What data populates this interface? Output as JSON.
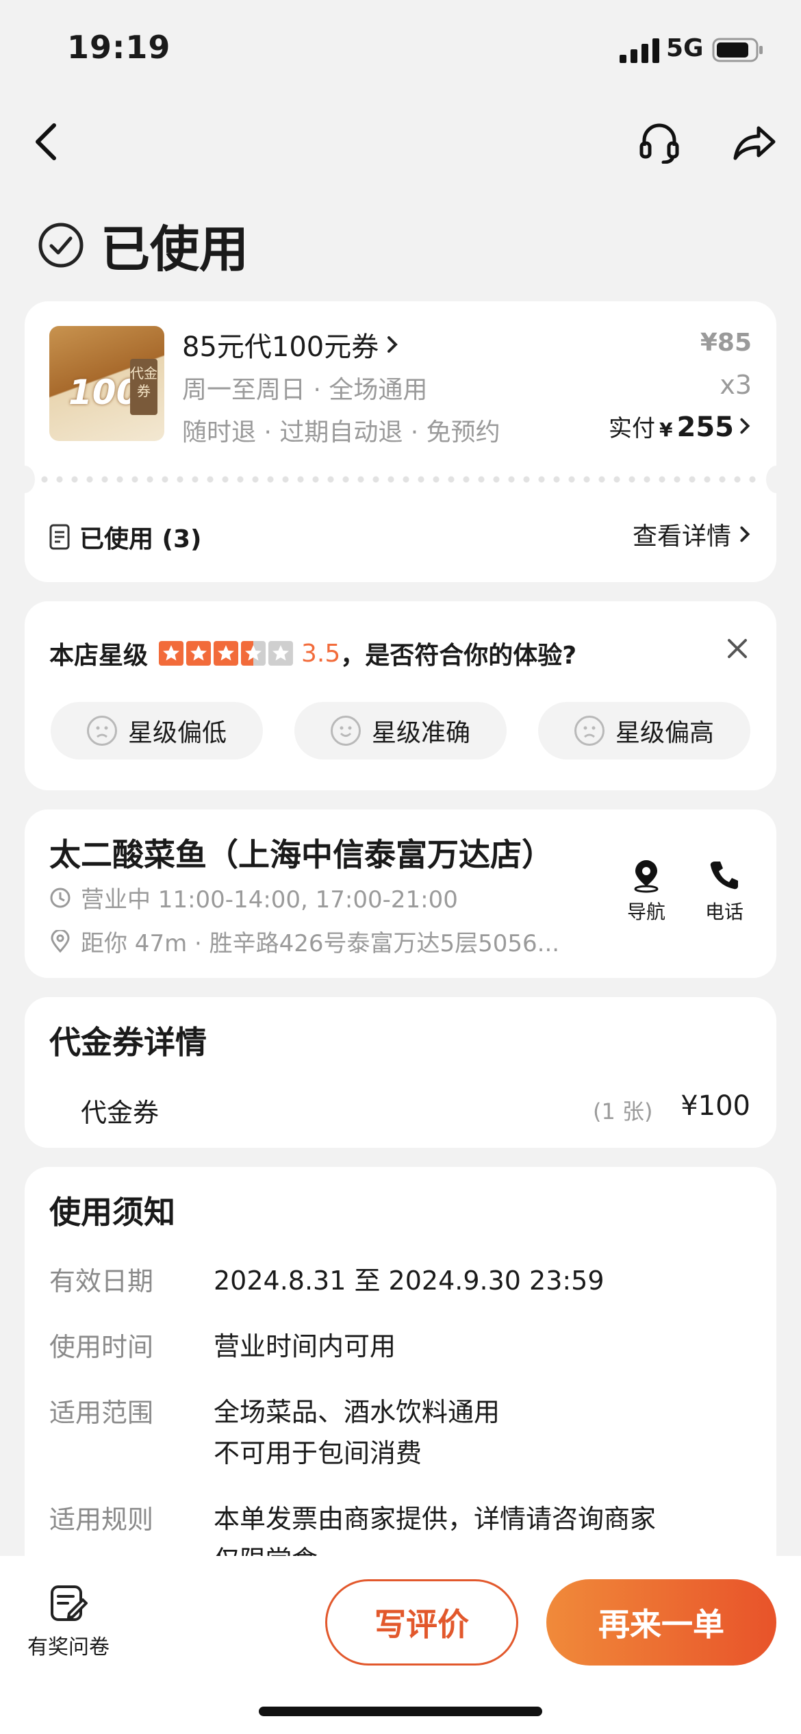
{
  "status_bar": {
    "time": "19:19",
    "network": "5G"
  },
  "header": {
    "status": "已使用"
  },
  "voucher": {
    "title": "85元代100元券",
    "days": "周一至周日 · 全场通用",
    "policy": "随时退 · 过期自动退 · 免预约",
    "unit_price": "¥85",
    "qty": "x3",
    "paid_label": "实付",
    "paid_currency": "¥",
    "paid_amount": "255",
    "thumb_number": "100",
    "thumb_tag": "代金券",
    "used_label": "已使用 (3)",
    "detail_link": "查看详情"
  },
  "rating": {
    "label": "本店星级",
    "score": "3.5",
    "score_value": 3.5,
    "question": "，是否符合你的体验?",
    "options": [
      "星级偏低",
      "星级准确",
      "星级偏高"
    ]
  },
  "store": {
    "name": "太二酸菜鱼（上海中信泰富万达店）",
    "hours": "营业中 11:00-14:00, 17:00-21:00",
    "distance": "距你 47m · 胜辛路426号泰富万达5层5056...",
    "nav_label": "导航",
    "phone_label": "电话"
  },
  "voucher_detail": {
    "title": "代金券详情",
    "item": "代金券",
    "count": "(1 张)",
    "price": "¥100"
  },
  "usage": {
    "title": "使用须知",
    "rows": [
      {
        "k": "有效日期",
        "v1": "2024.8.31 至 2024.9.30 23:59",
        "v2": ""
      },
      {
        "k": "使用时间",
        "v1": "营业时间内可用",
        "v2": ""
      },
      {
        "k": "适用范围",
        "v1": "全场菜品、酒水饮料通用",
        "v2": "不可用于包间消费"
      },
      {
        "k": "适用规则",
        "v1": "本单发票由商家提供，详情请咨询商家",
        "v2": "仅限堂食"
      }
    ]
  },
  "bottom": {
    "survey": "有奖问卷",
    "review": "写评价",
    "reorder": "再来一单"
  },
  "colors": {
    "accent": "#e8532a",
    "star": "#f26b3a"
  }
}
